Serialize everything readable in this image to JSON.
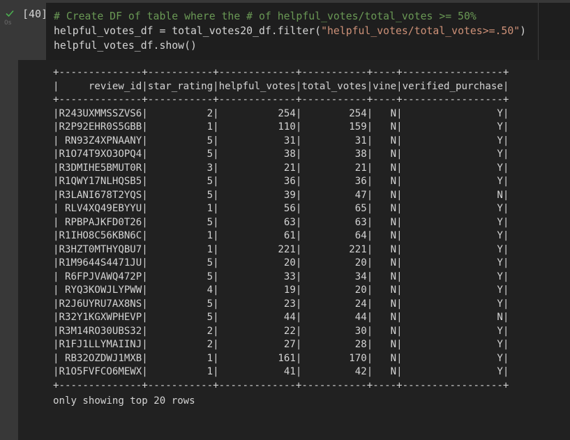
{
  "cell": {
    "execution_count": "[40]",
    "run_time": "0s",
    "code_lines": [
      [
        {
          "t": "# Create DF of table where the # of helpful_votes/total_votes >= 50%",
          "k": "comment"
        }
      ],
      [
        {
          "t": "helpful_votes_df = total_votes20_df.filter(",
          "k": "plain"
        },
        {
          "t": "\"helpful_votes/total_votes>=.50\"",
          "k": "string"
        },
        {
          "t": ")",
          "k": "plain"
        }
      ],
      [
        {
          "t": "helpful_votes_df.show()",
          "k": "plain"
        }
      ]
    ]
  },
  "output": {
    "columns": [
      "review_id",
      "star_rating",
      "helpful_votes",
      "total_votes",
      "vine",
      "verified_purchase"
    ],
    "rows": [
      [
        "R243UXMMSSZVS6",
        "2",
        "254",
        "254",
        "N",
        "Y"
      ],
      [
        "R2P92EHR0S5GBB",
        "1",
        "110",
        "159",
        "N",
        "Y"
      ],
      [
        "RN93Z4XPNAANY",
        "5",
        "31",
        "31",
        "N",
        "Y"
      ],
      [
        "R1O74T9XO3OPQ4",
        "5",
        "38",
        "38",
        "N",
        "Y"
      ],
      [
        "R3DMIHE5BMUT0R",
        "3",
        "21",
        "21",
        "N",
        "Y"
      ],
      [
        "R1QWY17NLHQSB5",
        "5",
        "36",
        "36",
        "N",
        "Y"
      ],
      [
        "R3LANI678T2YQS",
        "5",
        "39",
        "47",
        "N",
        "N"
      ],
      [
        "RLV4XQ49EBYYU",
        "1",
        "56",
        "65",
        "N",
        "Y"
      ],
      [
        "RPBPAJKFD0T26",
        "5",
        "63",
        "63",
        "N",
        "Y"
      ],
      [
        "R1IHO8C56KBN6C",
        "1",
        "61",
        "64",
        "N",
        "Y"
      ],
      [
        "R3HZT0MTHYQBU7",
        "1",
        "221",
        "221",
        "N",
        "Y"
      ],
      [
        "R1M9644S4471JU",
        "5",
        "20",
        "20",
        "N",
        "Y"
      ],
      [
        "R6FPJVAWQ472P",
        "5",
        "33",
        "34",
        "N",
        "Y"
      ],
      [
        "RYQ3KOWJLYPWW",
        "4",
        "19",
        "20",
        "N",
        "Y"
      ],
      [
        "R2J6UYRU7AX8NS",
        "5",
        "23",
        "24",
        "N",
        "Y"
      ],
      [
        "R32Y1KGXWPHEVP",
        "5",
        "44",
        "44",
        "N",
        "N"
      ],
      [
        "R3M14RO30UBS32",
        "2",
        "22",
        "30",
        "N",
        "Y"
      ],
      [
        "R1FJ1LLYMAIINJ",
        "2",
        "27",
        "28",
        "N",
        "Y"
      ],
      [
        "RB32OZDWJ1MXB",
        "1",
        "161",
        "170",
        "N",
        "Y"
      ],
      [
        "R1O5FVFCO6MEWX",
        "1",
        "41",
        "42",
        "N",
        "Y"
      ]
    ],
    "footer": "only showing top 20 rows"
  },
  "colors": {
    "check": "#4caf50",
    "comment": "#6a9955",
    "string": "#ce9178"
  }
}
